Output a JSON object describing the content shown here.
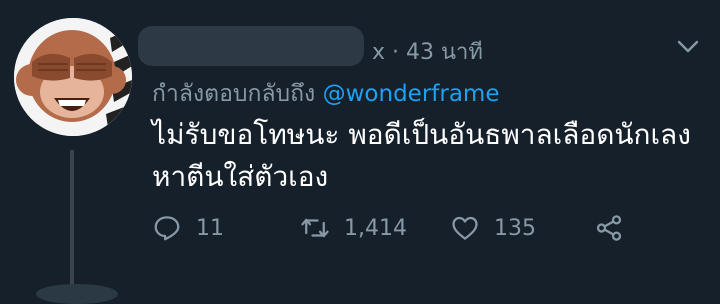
{
  "tweet": {
    "handle_tail": "x · 43 นาที",
    "reply_prefix": "กำลังตอบกลับถึง",
    "reply_mention": "@wonderframe",
    "line1": "ไม่รับขอโทษนะ พอดีเป็นอันธพาลเลือดนักเลง",
    "line2": "หาตีนใส่ตัวเอง"
  },
  "actions": {
    "reply_count": "11",
    "retweet_count": "1,414",
    "like_count": "135"
  },
  "colors": {
    "background": "#15202b",
    "secondary_text": "#8899a6",
    "link": "#1da1f2"
  },
  "icons": [
    "monkey-see-no-evil-avatar",
    "chevron-down-icon",
    "reply-icon",
    "retweet-icon",
    "like-icon",
    "share-icon"
  ]
}
